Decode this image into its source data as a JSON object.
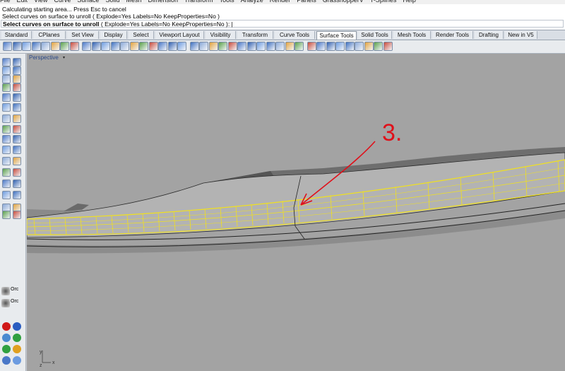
{
  "menu": {
    "items": [
      "File",
      "Edit",
      "View",
      "Curve",
      "Surface",
      "Solid",
      "Mesh",
      "Dimension",
      "Transform",
      "Tools",
      "Analyze",
      "Render",
      "Panels",
      "GrasshopperV",
      "T-Splines",
      "Help"
    ]
  },
  "command": {
    "history": [
      "Calculating starting area... Press Esc to cancel",
      "Select curves on surface to unroll ( Explode=Yes  Labels=No  KeepProperties=No )"
    ],
    "prompt_bold": "Select curves on surface to unroll",
    "prompt_rest": " ( Explode=Yes  Labels=No  KeepProperties=No ): |"
  },
  "tabs": [
    {
      "label": "Standard"
    },
    {
      "label": "CPlanes"
    },
    {
      "label": "Set View"
    },
    {
      "label": "Display"
    },
    {
      "label": "Select"
    },
    {
      "label": "Viewport Layout"
    },
    {
      "label": "Visibility"
    },
    {
      "label": "Transform"
    },
    {
      "label": "Curve Tools"
    },
    {
      "label": "Surface Tools",
      "active": true
    },
    {
      "label": "Solid Tools"
    },
    {
      "label": "Mesh Tools"
    },
    {
      "label": "Render Tools"
    },
    {
      "label": "Drafting"
    },
    {
      "label": "New in V5"
    }
  ],
  "viewport": {
    "title": "Perspective",
    "annotation": "3."
  },
  "osnap": {
    "labels": [
      "Orc",
      "Orc"
    ]
  },
  "axes": {
    "y": "y",
    "x": "x",
    "z": "z"
  },
  "colors": {
    "annotation": "#e0101a",
    "isocurve": "#f0e020",
    "surface": "#b3b3b3"
  }
}
